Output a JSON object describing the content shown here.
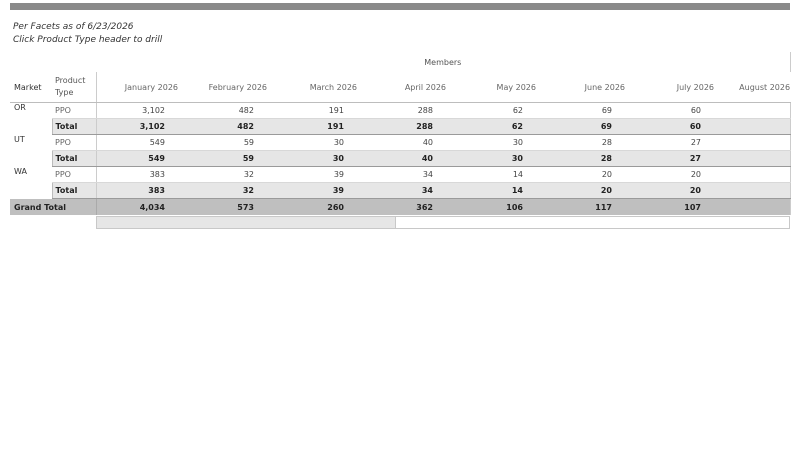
{
  "captions": {
    "line1": "Per Facets as of 6/23/2026",
    "line2": "Click Product Type header to drill"
  },
  "header": {
    "measure": "Members",
    "market": "Market",
    "product_type": "Product Type",
    "months": [
      "January 2026",
      "February 2026",
      "March 2026",
      "April 2026",
      "May 2026",
      "June 2026",
      "July 2026",
      "August 2026"
    ]
  },
  "groups": [
    {
      "market": "OR",
      "product": "PPO",
      "values": [
        "3,102",
        "482",
        "191",
        "288",
        "62",
        "69",
        "60",
        ""
      ],
      "total_label": "Total",
      "totals": [
        "3,102",
        "482",
        "191",
        "288",
        "62",
        "69",
        "60",
        ""
      ]
    },
    {
      "market": "UT",
      "product": "PPO",
      "values": [
        "549",
        "59",
        "30",
        "40",
        "30",
        "28",
        "27",
        ""
      ],
      "total_label": "Total",
      "totals": [
        "549",
        "59",
        "30",
        "40",
        "30",
        "28",
        "27",
        ""
      ]
    },
    {
      "market": "WA",
      "product": "PPO",
      "values": [
        "383",
        "32",
        "39",
        "34",
        "14",
        "20",
        "20",
        ""
      ],
      "total_label": "Total",
      "totals": [
        "383",
        "32",
        "39",
        "34",
        "14",
        "20",
        "20",
        ""
      ]
    }
  ],
  "grand_total": {
    "label": "Grand Total",
    "values": [
      "4,034",
      "573",
      "260",
      "362",
      "106",
      "117",
      "107",
      ""
    ]
  },
  "scrollbar": {
    "position": 0.0,
    "visible_fraction": 0.43
  }
}
